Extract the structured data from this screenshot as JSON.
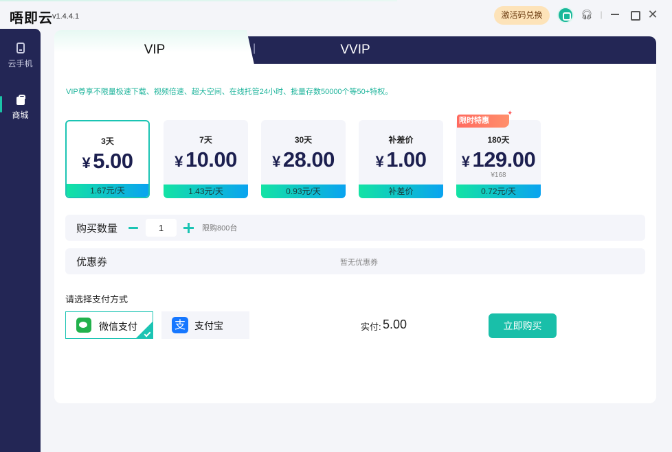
{
  "app": {
    "logo": "唔即云",
    "version": "v1.4.4.1"
  },
  "titlebar": {
    "activate_label": "激活码兑换",
    "separator": "|"
  },
  "sidebar": {
    "items": [
      {
        "label": "云手机"
      },
      {
        "label": "商城"
      }
    ]
  },
  "tabs": {
    "vip": "VIP",
    "divider": "|",
    "vvip": "VVIP"
  },
  "description": "VIP尊享不限量极速下载、视频倍速、超大空间、在线托管24小时、批量存数50000个等50+特权。",
  "plans": [
    {
      "days": "3天",
      "currency": "¥",
      "price": "5.00",
      "unit_price": "1.67元/天",
      "selected": true
    },
    {
      "days": "7天",
      "currency": "¥",
      "price": "10.00",
      "unit_price": "1.43元/天"
    },
    {
      "days": "30天",
      "currency": "¥",
      "price": "28.00",
      "unit_price": "0.93元/天"
    },
    {
      "days": "补差价",
      "currency": "¥",
      "price": "1.00",
      "unit_price": "补差价"
    },
    {
      "days": "180天",
      "currency": "¥",
      "price": "129.00",
      "original_price": "¥168",
      "unit_price": "0.72元/天",
      "tag": "限时特惠"
    }
  ],
  "quantity": {
    "label": "购买数量",
    "value": "1",
    "limit": "限购800台"
  },
  "coupon": {
    "label": "优惠券",
    "value": "暂无优惠券"
  },
  "payment": {
    "title": "请选择支付方式",
    "methods": [
      {
        "label": "微信支付",
        "selected": true
      },
      {
        "label": "支付宝",
        "icon_glyph": "支"
      }
    ],
    "amount_label": "实付:",
    "amount": "5.00",
    "buy_label": "立即购买"
  },
  "colors": {
    "accent": "#19bfa9",
    "sidebar": "#232655",
    "promo": "#ff6a5f"
  }
}
